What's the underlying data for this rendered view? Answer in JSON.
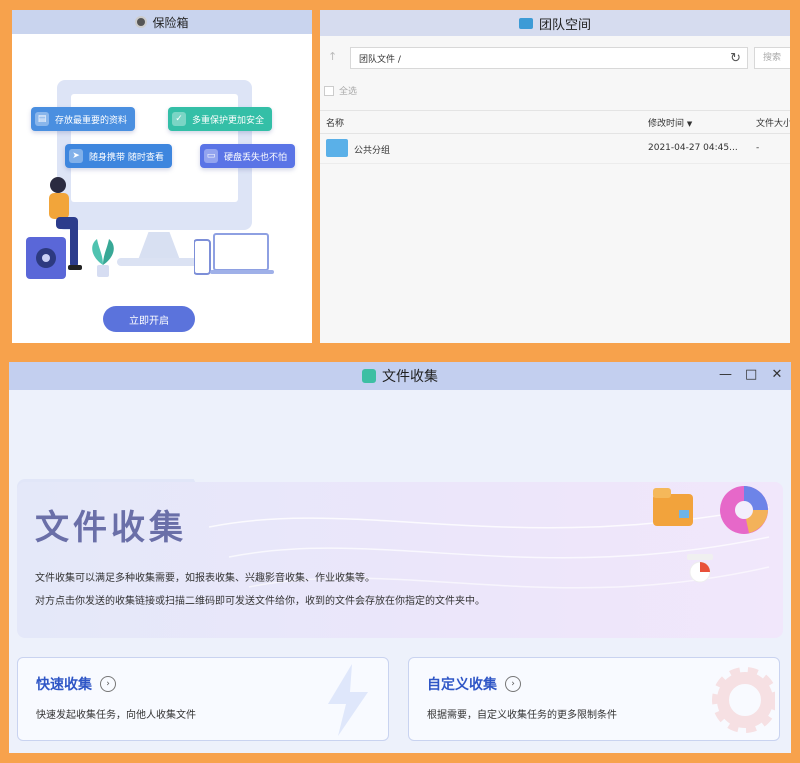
{
  "vault": {
    "title": "保险箱",
    "features": [
      {
        "label": "存放最重要的资料",
        "icon": "book-icon"
      },
      {
        "label": "多重保护更加安全",
        "icon": "shield-icon"
      },
      {
        "label": "随身携带 随时查看",
        "icon": "send-icon"
      },
      {
        "label": "硬盘丢失也不怕",
        "icon": "monitor-icon"
      }
    ],
    "start_button": "立即开启"
  },
  "team": {
    "title": "团队空间",
    "path": "团队文件 /",
    "search_placeholder": "搜索",
    "select_all": "全选",
    "columns": {
      "name": "名称",
      "modified": "修改时间",
      "size": "文件大小"
    },
    "rows": [
      {
        "name": "公共分组",
        "modified": "2021-04-27 04:45...",
        "size": "-"
      }
    ]
  },
  "collect": {
    "title": "文件收集",
    "hero_title": "文件收集",
    "desc1": "文件收集可以满足多种收集需要，如报表收集、兴趣影音收集、作业收集等。",
    "desc2": "对方点击你发送的收集链接或扫描二维码即可发送文件给你，收到的文件会存放在你指定的文件夹中。",
    "cards": [
      {
        "title": "快速收集",
        "desc": "快速发起收集任务，向他人收集文件"
      },
      {
        "title": "自定义收集",
        "desc": "根据需要，自定义收集任务的更多限制条件"
      }
    ]
  },
  "colors": {
    "accent": "#5b73dc",
    "card_title": "#2f56c6",
    "frame": "#f7a24c"
  }
}
